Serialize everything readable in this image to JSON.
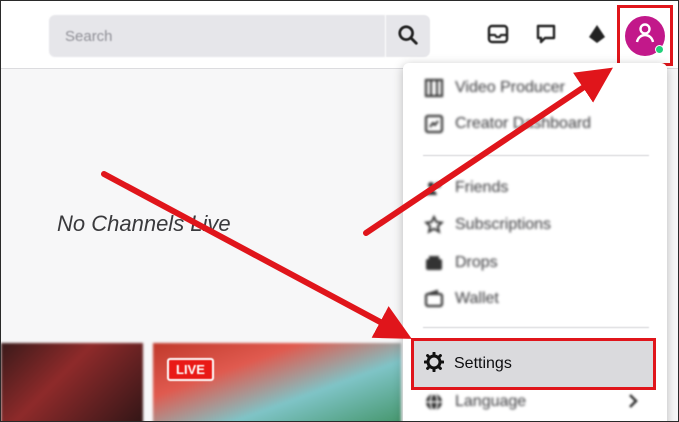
{
  "search": {
    "placeholder": "Search"
  },
  "header_icons": [
    "search-icon",
    "inbox-icon",
    "whispers-icon",
    "bits-icon"
  ],
  "user": {
    "avatar_color": "#c2188a",
    "status_color": "#22d07a"
  },
  "main": {
    "empty_message": "No Channels Live",
    "thumbnails": [
      {
        "badge": ""
      },
      {
        "badge": "LIVE"
      }
    ]
  },
  "menu": {
    "items": [
      {
        "label": "Video Producer",
        "icon": "film-icon"
      },
      {
        "label": "Creator Dashboard",
        "icon": "dashboard-icon"
      },
      {
        "label": "Friends",
        "icon": "friends-icon"
      },
      {
        "label": "Subscriptions",
        "icon": "star-icon"
      },
      {
        "label": "Drops",
        "icon": "drops-icon"
      },
      {
        "label": "Wallet",
        "icon": "wallet-icon"
      }
    ],
    "settings": {
      "label": "Settings",
      "icon": "gear-icon"
    },
    "language": {
      "label": "Language",
      "icon": "globe-icon"
    }
  },
  "highlight_color": "#e0151b"
}
